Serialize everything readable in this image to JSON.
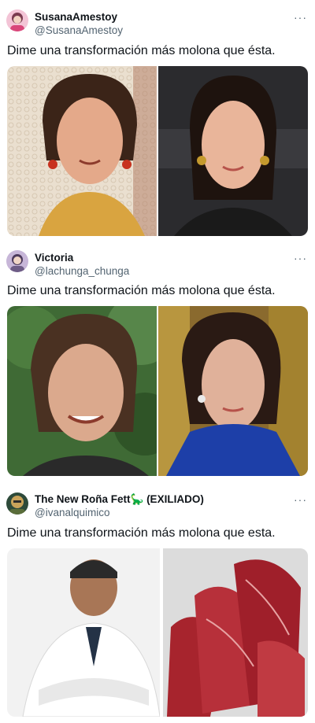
{
  "tweets": [
    {
      "author_name": "SusanaAmestoy",
      "author_handle": "@SusanaAmestoy",
      "text": "Dime una transformación más molona que ésta.",
      "more_label": "···",
      "images": [
        {
          "alt": "young woman with red earrings in traditional lace mantilla"
        },
        {
          "alt": "woman with dark hair and gold earrings at event"
        }
      ]
    },
    {
      "author_name": "Victoria",
      "author_handle": "@lachunga_chunga",
      "text": "Dime una transformación más molona que ésta.",
      "more_label": "···",
      "images": [
        {
          "alt": "smiling woman outdoors with trees behind"
        },
        {
          "alt": "woman in blue outfit with earrings"
        }
      ]
    },
    {
      "author_name": "The New Roña Fett🦕 (EXILIADO)",
      "author_handle": "@ivanalquimico",
      "text": "Dime una transformación más molona que esta.",
      "more_label": "···",
      "images": [
        {
          "alt": "man in white lab coat with arms crossed"
        },
        {
          "alt": "raw red beef steaks on paper"
        }
      ]
    }
  ]
}
